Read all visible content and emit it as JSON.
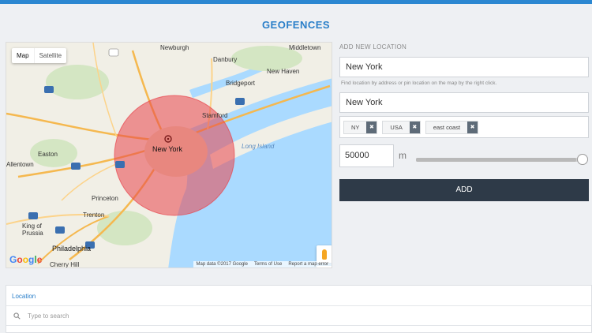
{
  "page": {
    "title": "GEOFENCES"
  },
  "map": {
    "type_buttons": [
      "Map",
      "Satellite"
    ],
    "place_labels": [
      "Newburgh",
      "Danbury",
      "Middletown",
      "New Haven",
      "Bridgeport",
      "Stamford",
      "Long Island",
      "New York",
      "Easton",
      "Allentown",
      "Princeton",
      "Trenton",
      "King of Prussia",
      "Philadelphia",
      "Cherry Hill"
    ],
    "road_labels": [
      "209",
      "87",
      "84",
      "95",
      "380",
      "476",
      "78",
      "287",
      "295",
      "276",
      "76"
    ],
    "zoom_in": "+",
    "zoom_out": "−",
    "google_logo": [
      "G",
      "o",
      "o",
      "g",
      "l",
      "e"
    ],
    "attribution": {
      "data": "Map data ©2017 Google",
      "terms": "Terms of Use",
      "report": "Report a map error"
    }
  },
  "form": {
    "section_label": "ADD NEW LOCATION",
    "name_value": "New York",
    "hint": "Find location by address or pin location on the map by the right click.",
    "address_value": "New York",
    "tags": [
      "NY",
      "USA",
      "east coast"
    ],
    "tag_remove_glyph": "✖",
    "radius_value": "50000",
    "radius_unit": "m",
    "radius_slider_level": 0.95,
    "add_label": "ADD"
  },
  "list": {
    "column_location": "Location",
    "search_placeholder": "Type to search"
  },
  "colors": {
    "accent": "#2a7fc9",
    "topbar": "#2b87d1",
    "button": "#2e3a48",
    "circle": "#e8434b"
  }
}
